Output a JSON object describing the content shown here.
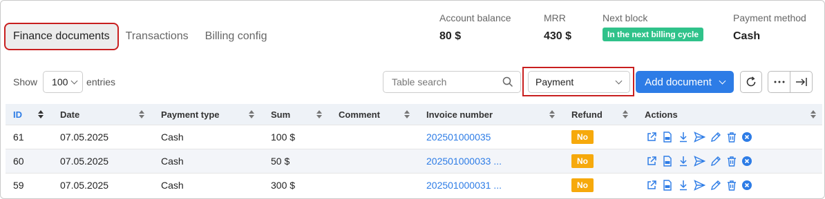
{
  "tabs": [
    {
      "label": "Finance documents",
      "active": true
    },
    {
      "label": "Transactions",
      "active": false
    },
    {
      "label": "Billing config",
      "active": false
    }
  ],
  "stats": {
    "account_balance": {
      "label": "Account balance",
      "value": "80 $"
    },
    "mrr": {
      "label": "MRR",
      "value": "430 $"
    },
    "next_block": {
      "label": "Next block",
      "value": "In the next billing cycle"
    },
    "payment_method": {
      "label": "Payment method",
      "value": "Cash"
    }
  },
  "controls": {
    "show_label": "Show",
    "entries_value": "100",
    "entries_label": "entries",
    "search_placeholder": "Table search",
    "type_filter": "Payment",
    "add_button": "Add document"
  },
  "table": {
    "headers": [
      "ID",
      "Date",
      "Payment type",
      "Sum",
      "Comment",
      "Invoice number",
      "Refund",
      "Actions"
    ],
    "rows": [
      {
        "id": "61",
        "date": "07.05.2025",
        "payment_type": "Cash",
        "sum": "100 $",
        "comment": "",
        "invoice": "202501000035",
        "refund": "No"
      },
      {
        "id": "60",
        "date": "07.05.2025",
        "payment_type": "Cash",
        "sum": "50 $",
        "comment": "",
        "invoice": "202501000033  ...",
        "refund": "No"
      },
      {
        "id": "59",
        "date": "07.05.2025",
        "payment_type": "Cash",
        "sum": "300 $",
        "comment": "",
        "invoice": "202501000031  ...",
        "refund": "No"
      }
    ]
  },
  "colors": {
    "accent": "#2d7ce6",
    "badge_green": "#2fc28a",
    "badge_orange": "#f6a90c",
    "highlight": "#c81e1e"
  }
}
